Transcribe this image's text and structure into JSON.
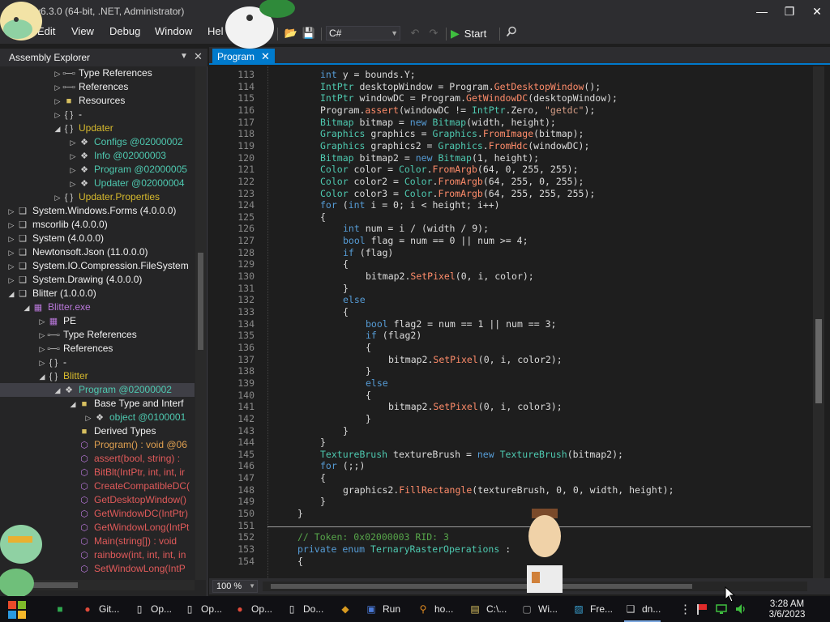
{
  "window": {
    "title": "v6.3.0 (64-bit, .NET, Administrator)",
    "minimize": "—",
    "maximize": "❐",
    "close": "✕"
  },
  "menu": {
    "items": [
      "Edit",
      "View",
      "Debug",
      "Window",
      "Hel"
    ]
  },
  "toolbar": {
    "language": "C#",
    "start_label": "Start"
  },
  "left_panel": {
    "title": "Assembly Explorer",
    "tree": [
      {
        "indent": 3,
        "exp": "▷",
        "icon": "ref",
        "text": "Type References",
        "color": "c-white"
      },
      {
        "indent": 3,
        "exp": "▷",
        "icon": "ref",
        "text": "References",
        "color": "c-white"
      },
      {
        "indent": 3,
        "exp": "▷",
        "icon": "folder",
        "text": "Resources",
        "color": "c-white"
      },
      {
        "indent": 3,
        "exp": "▷",
        "icon": "ns",
        "text": "-",
        "color": "c-white"
      },
      {
        "indent": 3,
        "exp": "◢",
        "icon": "ns",
        "text": "Updater",
        "color": "c-yellow"
      },
      {
        "indent": 4,
        "exp": "▷",
        "icon": "class",
        "text": "Configs @02000002",
        "color": "c-teal"
      },
      {
        "indent": 4,
        "exp": "▷",
        "icon": "class",
        "text": "Info @02000003",
        "color": "c-teal"
      },
      {
        "indent": 4,
        "exp": "▷",
        "icon": "class",
        "text": "Program @02000005",
        "color": "c-teal"
      },
      {
        "indent": 4,
        "exp": "▷",
        "icon": "class",
        "text": "Updater @02000004",
        "color": "c-teal"
      },
      {
        "indent": 3,
        "exp": "▷",
        "icon": "ns",
        "text": "Updater.Properties",
        "color": "c-yellow"
      },
      {
        "indent": 0,
        "exp": "▷",
        "icon": "asm",
        "text": "System.Windows.Forms (4.0.0.0)",
        "color": "c-white"
      },
      {
        "indent": 0,
        "exp": "▷",
        "icon": "asm",
        "text": "mscorlib (4.0.0.0)",
        "color": "c-white"
      },
      {
        "indent": 0,
        "exp": "▷",
        "icon": "asm",
        "text": "System (4.0.0.0)",
        "color": "c-white"
      },
      {
        "indent": 0,
        "exp": "▷",
        "icon": "asm",
        "text": "Newtonsoft.Json (11.0.0.0)",
        "color": "c-white"
      },
      {
        "indent": 0,
        "exp": "▷",
        "icon": "asm",
        "text": "System.IO.Compression.FileSystem",
        "color": "c-white"
      },
      {
        "indent": 0,
        "exp": "▷",
        "icon": "asm",
        "text": "System.Drawing (4.0.0.0)",
        "color": "c-white"
      },
      {
        "indent": 0,
        "exp": "◢",
        "icon": "asm",
        "text": "Blitter (1.0.0.0)",
        "color": "c-white"
      },
      {
        "indent": 1,
        "exp": "◢",
        "icon": "module",
        "text": "Blitter.exe",
        "color": "c-purple"
      },
      {
        "indent": 2,
        "exp": "▷",
        "icon": "module",
        "text": "PE",
        "color": "c-white"
      },
      {
        "indent": 2,
        "exp": "▷",
        "icon": "ref",
        "text": "Type References",
        "color": "c-white"
      },
      {
        "indent": 2,
        "exp": "▷",
        "icon": "ref",
        "text": "References",
        "color": "c-white"
      },
      {
        "indent": 2,
        "exp": "▷",
        "icon": "ns",
        "text": "-",
        "color": "c-white"
      },
      {
        "indent": 2,
        "exp": "◢",
        "icon": "ns",
        "text": "Blitter",
        "color": "c-yellow"
      },
      {
        "indent": 3,
        "exp": "◢",
        "icon": "class",
        "text": "Program @02000002",
        "color": "c-teal",
        "selected": true
      },
      {
        "indent": 4,
        "exp": "◢",
        "icon": "folder",
        "text": "Base Type and Interf",
        "color": "c-white"
      },
      {
        "indent": 5,
        "exp": "▷",
        "icon": "class",
        "text": "object @0100001",
        "color": "c-teal"
      },
      {
        "indent": 4,
        "exp": "",
        "icon": "folder",
        "text": "Derived Types",
        "color": "c-white"
      },
      {
        "indent": 4,
        "exp": "",
        "icon": "method",
        "text": "Program() : void @06",
        "color": "c-orange"
      },
      {
        "indent": 4,
        "exp": "",
        "icon": "lock",
        "text": "assert(bool, string) :",
        "color": "c-red"
      },
      {
        "indent": 4,
        "exp": "",
        "icon": "lock",
        "text": "BitBlt(IntPtr, int, int, ir",
        "color": "c-red"
      },
      {
        "indent": 4,
        "exp": "",
        "icon": "lock",
        "text": "CreateCompatibleDC(",
        "color": "c-red"
      },
      {
        "indent": 4,
        "exp": "",
        "icon": "lock",
        "text": "GetDesktopWindow()",
        "color": "c-red"
      },
      {
        "indent": 4,
        "exp": "",
        "icon": "lock",
        "text": "GetWindowDC(IntPtr)",
        "color": "c-red"
      },
      {
        "indent": 4,
        "exp": "",
        "icon": "lock",
        "text": "GetWindowLong(IntPt",
        "color": "c-red"
      },
      {
        "indent": 4,
        "exp": "",
        "icon": "lock",
        "text": "Main(string[]) : void",
        "color": "c-red"
      },
      {
        "indent": 4,
        "exp": "",
        "icon": "lock",
        "text": "rainbow(int, int, int, in",
        "color": "c-red"
      },
      {
        "indent": 4,
        "exp": "",
        "icon": "lock",
        "text": "SetWindowLong(IntP",
        "color": "c-red"
      }
    ]
  },
  "editor": {
    "tab_label": "Program",
    "tab_close": "✕",
    "zoom": "100 %",
    "lines": [
      {
        "n": "113",
        "i": 3,
        "h": "<span class='k'>int</span> y = bounds.Y;"
      },
      {
        "n": "114",
        "i": 3,
        "h": "<span class='t'>IntPtr</span> desktopWindow = Program.<span class='m'>GetDesktopWindow</span>();"
      },
      {
        "n": "115",
        "i": 3,
        "h": "<span class='t'>IntPtr</span> windowDC = Program.<span class='m'>GetWindowDC</span>(desktopWindow);"
      },
      {
        "n": "116",
        "i": 3,
        "h": "Program.<span class='m'>assert</span>(windowDC != <span class='t'>IntPtr</span>.Zero, <span class='s'>\"getdc\"</span>);"
      },
      {
        "n": "117",
        "i": 3,
        "h": "<span class='t'>Bitmap</span> bitmap = <span class='k'>new</span> <span class='t'>Bitmap</span>(width, height);"
      },
      {
        "n": "118",
        "i": 3,
        "h": "<span class='t'>Graphics</span> graphics = <span class='t'>Graphics</span>.<span class='m'>FromImage</span>(bitmap);"
      },
      {
        "n": "119",
        "i": 3,
        "h": "<span class='t'>Graphics</span> graphics2 = <span class='t'>Graphics</span>.<span class='m'>FromHdc</span>(windowDC);"
      },
      {
        "n": "120",
        "i": 3,
        "h": "<span class='t'>Bitmap</span> bitmap2 = <span class='k'>new</span> <span class='t'>Bitmap</span>(1, height);"
      },
      {
        "n": "121",
        "i": 3,
        "h": "<span class='t'>Color</span> color = <span class='t'>Color</span>.<span class='m'>FromArgb</span>(64, 0, 255, 255);"
      },
      {
        "n": "122",
        "i": 3,
        "h": "<span class='t'>Color</span> color2 = <span class='t'>Color</span>.<span class='m'>FromArgb</span>(64, 255, 0, 255);"
      },
      {
        "n": "123",
        "i": 3,
        "h": "<span class='t'>Color</span> color3 = <span class='t'>Color</span>.<span class='m'>FromArgb</span>(64, 255, 255, 255);"
      },
      {
        "n": "124",
        "i": 3,
        "h": "<span class='k'>for</span> (<span class='k'>int</span> i = 0; i &lt; height; i++)"
      },
      {
        "n": "125",
        "i": 3,
        "h": "{"
      },
      {
        "n": "126",
        "i": 4,
        "h": "<span class='k'>int</span> num = i / (width / 9);"
      },
      {
        "n": "127",
        "i": 4,
        "h": "<span class='k'>bool</span> flag = num == 0 || num &gt;= 4;"
      },
      {
        "n": "128",
        "i": 4,
        "h": "<span class='k'>if</span> (flag)"
      },
      {
        "n": "129",
        "i": 4,
        "h": "{"
      },
      {
        "n": "130",
        "i": 5,
        "h": "bitmap2.<span class='m'>SetPixel</span>(0, i, color);"
      },
      {
        "n": "131",
        "i": 4,
        "h": "}"
      },
      {
        "n": "132",
        "i": 4,
        "h": "<span class='k'>else</span>"
      },
      {
        "n": "133",
        "i": 4,
        "h": "{"
      },
      {
        "n": "134",
        "i": 5,
        "h": "<span class='k'>bool</span> flag2 = num == 1 || num == 3;"
      },
      {
        "n": "135",
        "i": 5,
        "h": "<span class='k'>if</span> (flag2)"
      },
      {
        "n": "136",
        "i": 5,
        "h": "{"
      },
      {
        "n": "137",
        "i": 6,
        "h": "bitmap2.<span class='m'>SetPixel</span>(0, i, color2);"
      },
      {
        "n": "138",
        "i": 5,
        "h": "}"
      },
      {
        "n": "139",
        "i": 5,
        "h": "<span class='k'>else</span>"
      },
      {
        "n": "140",
        "i": 5,
        "h": "{"
      },
      {
        "n": "141",
        "i": 6,
        "h": "bitmap2.<span class='m'>SetPixel</span>(0, i, color3);"
      },
      {
        "n": "142",
        "i": 5,
        "h": "}"
      },
      {
        "n": "143",
        "i": 4,
        "h": "}"
      },
      {
        "n": "144",
        "i": 3,
        "h": "}"
      },
      {
        "n": "145",
        "i": 3,
        "h": "<span class='t'>TextureBrush</span> textureBrush = <span class='k'>new</span> <span class='t'>TextureBrush</span>(bitmap2);"
      },
      {
        "n": "146",
        "i": 3,
        "h": "<span class='k'>for</span> (;;)"
      },
      {
        "n": "147",
        "i": 3,
        "h": "{"
      },
      {
        "n": "148",
        "i": 4,
        "h": "graphics2.<span class='m'>FillRectangle</span>(textureBrush, 0, 0, width, height);"
      },
      {
        "n": "149",
        "i": 3,
        "h": "}"
      },
      {
        "n": "150",
        "i": 2,
        "h": "}"
      },
      {
        "n": "151",
        "i": 2,
        "h": ""
      },
      {
        "n": "152",
        "i": 2,
        "h": "<span class='cm'>// Token: 0x02000003 RID: 3</span>"
      },
      {
        "n": "153",
        "i": 2,
        "h": "<span class='k'>private enum</span> <span class='t'>TernaryRasterOperations</span> :"
      },
      {
        "n": "154",
        "i": 2,
        "h": "{"
      }
    ]
  },
  "taskbar": {
    "items": [
      {
        "label": "",
        "icon": "chat",
        "color": "#2fa84f"
      },
      {
        "label": "Git...",
        "icon": "chrome",
        "color": "#e04a3a"
      },
      {
        "label": "Op...",
        "icon": "doc",
        "color": "#e8e8e8"
      },
      {
        "label": "Op...",
        "icon": "doc",
        "color": "#e8e8e8"
      },
      {
        "label": "Op...",
        "icon": "chrome",
        "color": "#e04a3a"
      },
      {
        "label": "Do...",
        "icon": "doc",
        "color": "#e8e8e8"
      },
      {
        "label": "",
        "icon": "shield",
        "color": "#d89a20"
      },
      {
        "label": "Run",
        "icon": "run",
        "color": "#4a7ad8"
      },
      {
        "label": "ho...",
        "icon": "search",
        "color": "#e08a20"
      },
      {
        "label": "C:\\...",
        "icon": "folder",
        "color": "#d8c060"
      },
      {
        "label": "Wi...",
        "icon": "window",
        "color": "#a0a0a0"
      },
      {
        "label": "Fre...",
        "icon": "tool",
        "color": "#3aa0d0"
      },
      {
        "label": "dn...",
        "icon": "dnspy",
        "color": "#d0d0d0"
      }
    ],
    "time": "3:28 AM",
    "date": "3/6/2023"
  }
}
